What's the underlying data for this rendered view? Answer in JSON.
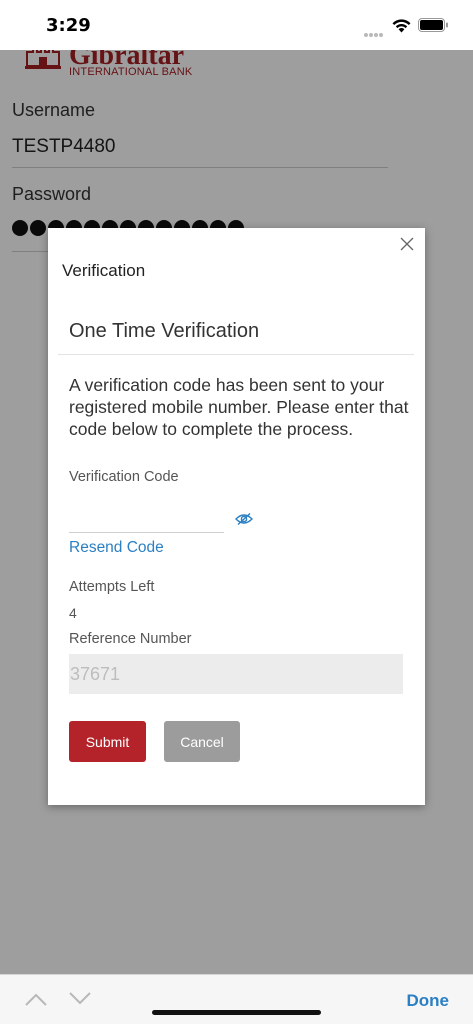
{
  "status_bar": {
    "time": "3:29"
  },
  "background": {
    "logo": {
      "brand": "Gibraltar",
      "sub": "INTERNATIONAL BANK"
    },
    "username": {
      "label": "Username",
      "value": "TESTP4480"
    },
    "password": {
      "label": "Password",
      "mask_count": 13
    }
  },
  "modal": {
    "title": "Verification",
    "section_title": "One Time Verification",
    "message": "A verification code has been sent to your registered mobile number. Please enter that code below to complete the process.",
    "code_label": "Verification Code",
    "code_value": "",
    "resend": "Resend Code",
    "attempts_label": "Attempts Left",
    "attempts_value": "4",
    "reference_label": "Reference Number",
    "reference_value": "37671",
    "submit": "Submit",
    "cancel": "Cancel"
  },
  "accessory": {
    "done": "Done"
  },
  "colors": {
    "brand_red": "#b4232a",
    "link_blue": "#2b7fc3",
    "cancel_gray": "#9c9c9c"
  }
}
